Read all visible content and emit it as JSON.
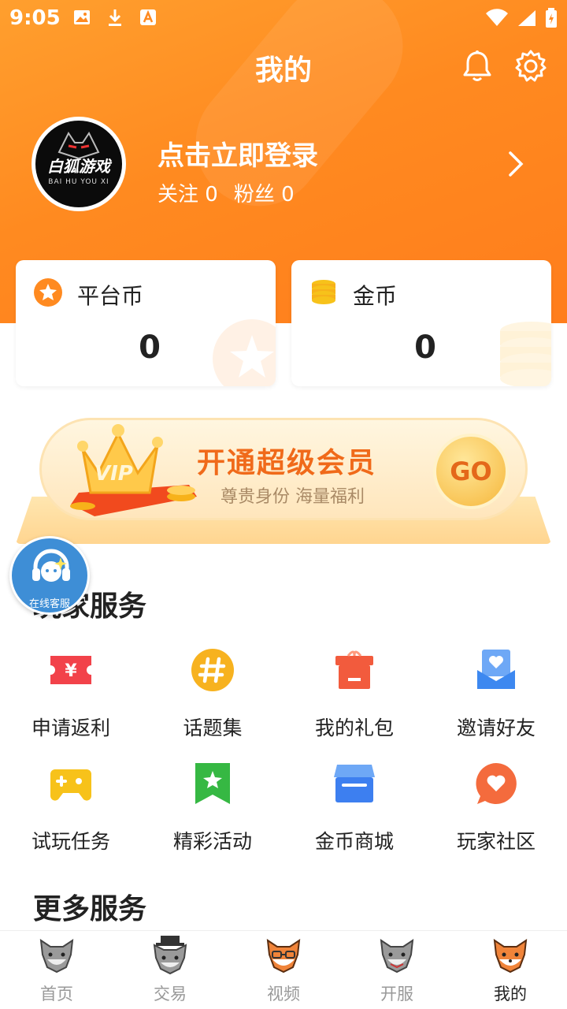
{
  "status_bar": {
    "time": "9:05"
  },
  "header": {
    "title": "我的"
  },
  "profile": {
    "avatar_text": "白狐游戏",
    "avatar_subtext": "BAI HU YOU XI",
    "login_prompt": "点击立即登录",
    "follow_label": "关注",
    "follow_count": "0",
    "fans_label": "粉丝",
    "fans_count": "0"
  },
  "cards": [
    {
      "label": "平台币",
      "value": "0",
      "icon": "star-coin-icon"
    },
    {
      "label": "金币",
      "value": "0",
      "icon": "gold-coins-icon"
    }
  ],
  "vip_banner": {
    "badge": "VIP",
    "title": "开通超级会员",
    "subtitle": "尊贵身份 海量福利",
    "go_label": "GO"
  },
  "floating_service": {
    "label": "在线客服"
  },
  "sections": {
    "player_services": "玩家服务",
    "more_services": "更多服务"
  },
  "services": [
    {
      "label": "申请返利",
      "icon": "rebate-ticket-icon",
      "color": "#f2424a"
    },
    {
      "label": "话题集",
      "icon": "hashtag-icon",
      "color": "#f7b21f"
    },
    {
      "label": "我的礼包",
      "icon": "gift-box-icon",
      "color": "#f25b3d"
    },
    {
      "label": "邀请好友",
      "icon": "invite-heart-icon",
      "color": "#3d88f0"
    },
    {
      "label": "试玩任务",
      "icon": "gamepad-icon",
      "color": "#f7c21a"
    },
    {
      "label": "精彩活动",
      "icon": "bookmark-star-icon",
      "color": "#36b843"
    },
    {
      "label": "金币商城",
      "icon": "store-icon",
      "color": "#3d7ff0"
    },
    {
      "label": "玩家社区",
      "icon": "chat-heart-icon",
      "color": "#f46b3d"
    }
  ],
  "bottom_nav": [
    {
      "label": "首页",
      "icon": "wolf-home-icon",
      "active": false
    },
    {
      "label": "交易",
      "icon": "wolf-hat-icon",
      "active": false
    },
    {
      "label": "视频",
      "icon": "fox-glasses-icon",
      "active": false
    },
    {
      "label": "开服",
      "icon": "wolf-server-icon",
      "active": false
    },
    {
      "label": "我的",
      "icon": "fox-profile-icon",
      "active": true
    }
  ],
  "colors": {
    "brand_orange": "#ff8a20",
    "vip_orange": "#f06a1a",
    "nav_inactive": "#999999",
    "nav_active": "#222222"
  }
}
